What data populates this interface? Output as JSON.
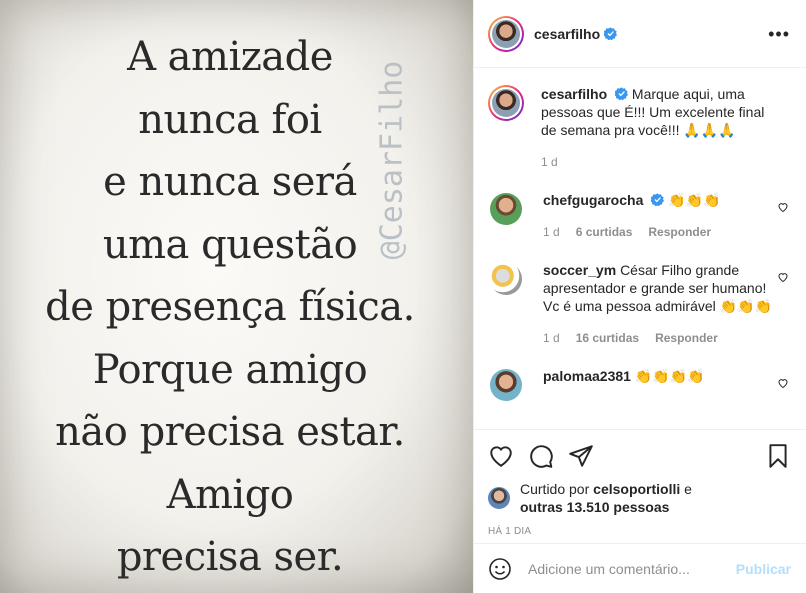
{
  "post_image": {
    "quote_lines": [
      "A amizade",
      "nunca foi",
      "e nunca será",
      "uma questão",
      "de presença física.",
      "Porque amigo",
      "não precisa estar.",
      "Amigo",
      "precisa ser."
    ],
    "watermark": "@CesarFilho"
  },
  "header": {
    "username": "cesarfilho",
    "verified": true,
    "more_label": "•••"
  },
  "caption": {
    "username": "cesarfilho",
    "text": "Marque aqui, uma pessoas que É!!! Um excelente final de semana pra você!!! 🙏🙏🙏",
    "time": "1 d"
  },
  "comments": [
    {
      "username": "chefgugarocha",
      "verified": true,
      "text": "👏👏👏",
      "time": "1 d",
      "likes": "6 curtidas",
      "reply": "Responder"
    },
    {
      "username": "soccer_ym",
      "verified": false,
      "text": "César Filho grande apresentador e grande ser humano! Vc é uma pessoa admirável 👏👏👏",
      "time": "1 d",
      "likes": "16 curtidas",
      "reply": "Responder"
    },
    {
      "username": "palomaa2381",
      "verified": false,
      "text": "👏👏👏👏",
      "time": "",
      "likes": "",
      "reply": ""
    }
  ],
  "likes_summary": {
    "prefix": "Curtido por",
    "user": "celsoportiolli",
    "middle": "e",
    "others": "outras 13.510 pessoas"
  },
  "post_time": "Há 1 dia",
  "add_comment": {
    "placeholder": "Adicione um comentário...",
    "publish_label": "Publicar"
  },
  "colors": {
    "verified": "#3897f0",
    "publish_disabled": "#b2dffc",
    "muted": "#8e8e8e"
  }
}
